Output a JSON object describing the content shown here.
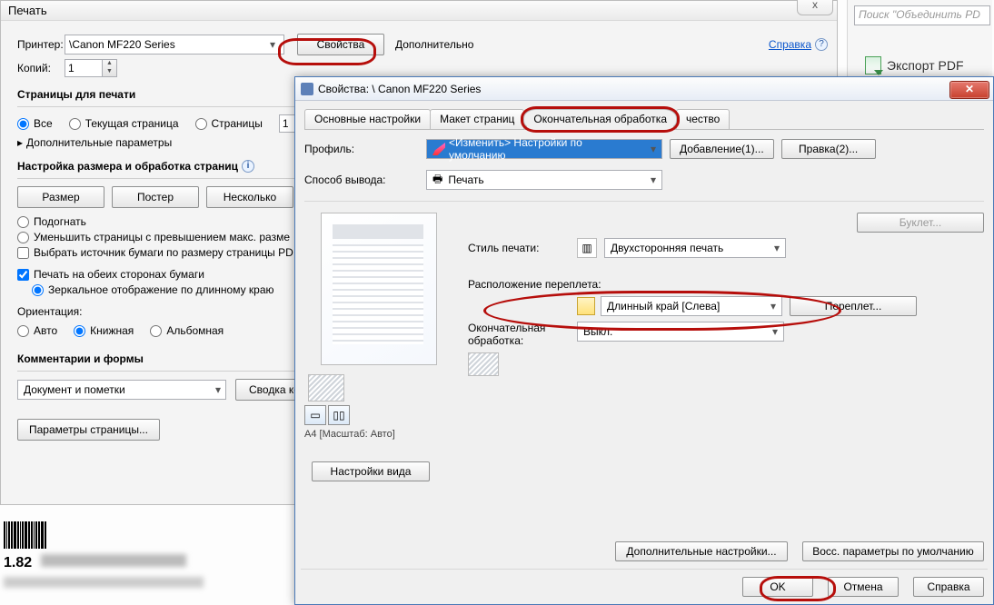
{
  "printDialog": {
    "title": "Печать",
    "printerLabel": "Принтер:",
    "printerValue": "\\Canon MF220 Series",
    "properties": "Свойства",
    "advanced": "Дополнительно",
    "help": "Справка",
    "copiesLabel": "Копий:",
    "copiesValue": "1",
    "pagesGroup": "Страницы для печати",
    "radios": {
      "all": "Все",
      "current": "Текущая страница",
      "pages": "Страницы"
    },
    "pagesInput": "1",
    "moreParams": "Дополнительные параметры",
    "sizingGroup": "Настройка размера и обработка страниц",
    "btns": {
      "size": "Размер",
      "poster": "Постер",
      "multi": "Несколько"
    },
    "fit": "Подогнать",
    "shrink": "Уменьшить страницы с превышением макс. разме",
    "chooseSource": "Выбрать источник бумаги по размеру страницы PD",
    "duplex": "Печать на обеих сторонах бумаги",
    "mirror": "Зеркальное отображение по длинному краю",
    "orientationLabel": "Ориентация:",
    "orient": {
      "auto": "Авто",
      "portrait": "Книжная",
      "landscape": "Альбомная"
    },
    "commentsGroup": "Комментарии и формы",
    "commentsDD": "Документ и пометки",
    "summary": "Сводка ком",
    "pageSetup": "Параметры страницы...",
    "closeX": "x"
  },
  "rightPane": {
    "searchPlaceholder": "Поиск \"Объединить PD",
    "exportPDF": "Экспорт PDF"
  },
  "props": {
    "title": "Свойства: \\           Canon MF220 Series",
    "tabs": [
      "Основные настройки",
      "Макет страниц",
      "Окончательная обработка",
      "чество"
    ],
    "profileLabel": "Профиль:",
    "profileValue": "<Изменить> Настройки по умолчанию",
    "addBtn": "Добавление(1)...",
    "editBtn": "Правка(2)...",
    "outputLabel": "Способ вывода:",
    "outputValue": "Печать",
    "bookletBtn": "Буклет...",
    "styleLabel": "Стиль печати:",
    "styleValue": "Двухсторонняя печать",
    "bindLabel": "Расположение переплета:",
    "bindValue": "Длинный край [Слева]",
    "bindBtn": "Переплет...",
    "finishLabel": "Окончательная обработка:",
    "finishValue": "Выкл.",
    "viewSettings": "Настройки вида",
    "previewCaption": "A4 [Масштаб: Авто]",
    "advSettings": "Дополнительные настройки...",
    "restore": "Восс. параметры по умолчанию",
    "ok": "OK",
    "cancel": "Отмена",
    "helpBtn": "Справка"
  },
  "bottom": {
    "num": "1.82"
  }
}
